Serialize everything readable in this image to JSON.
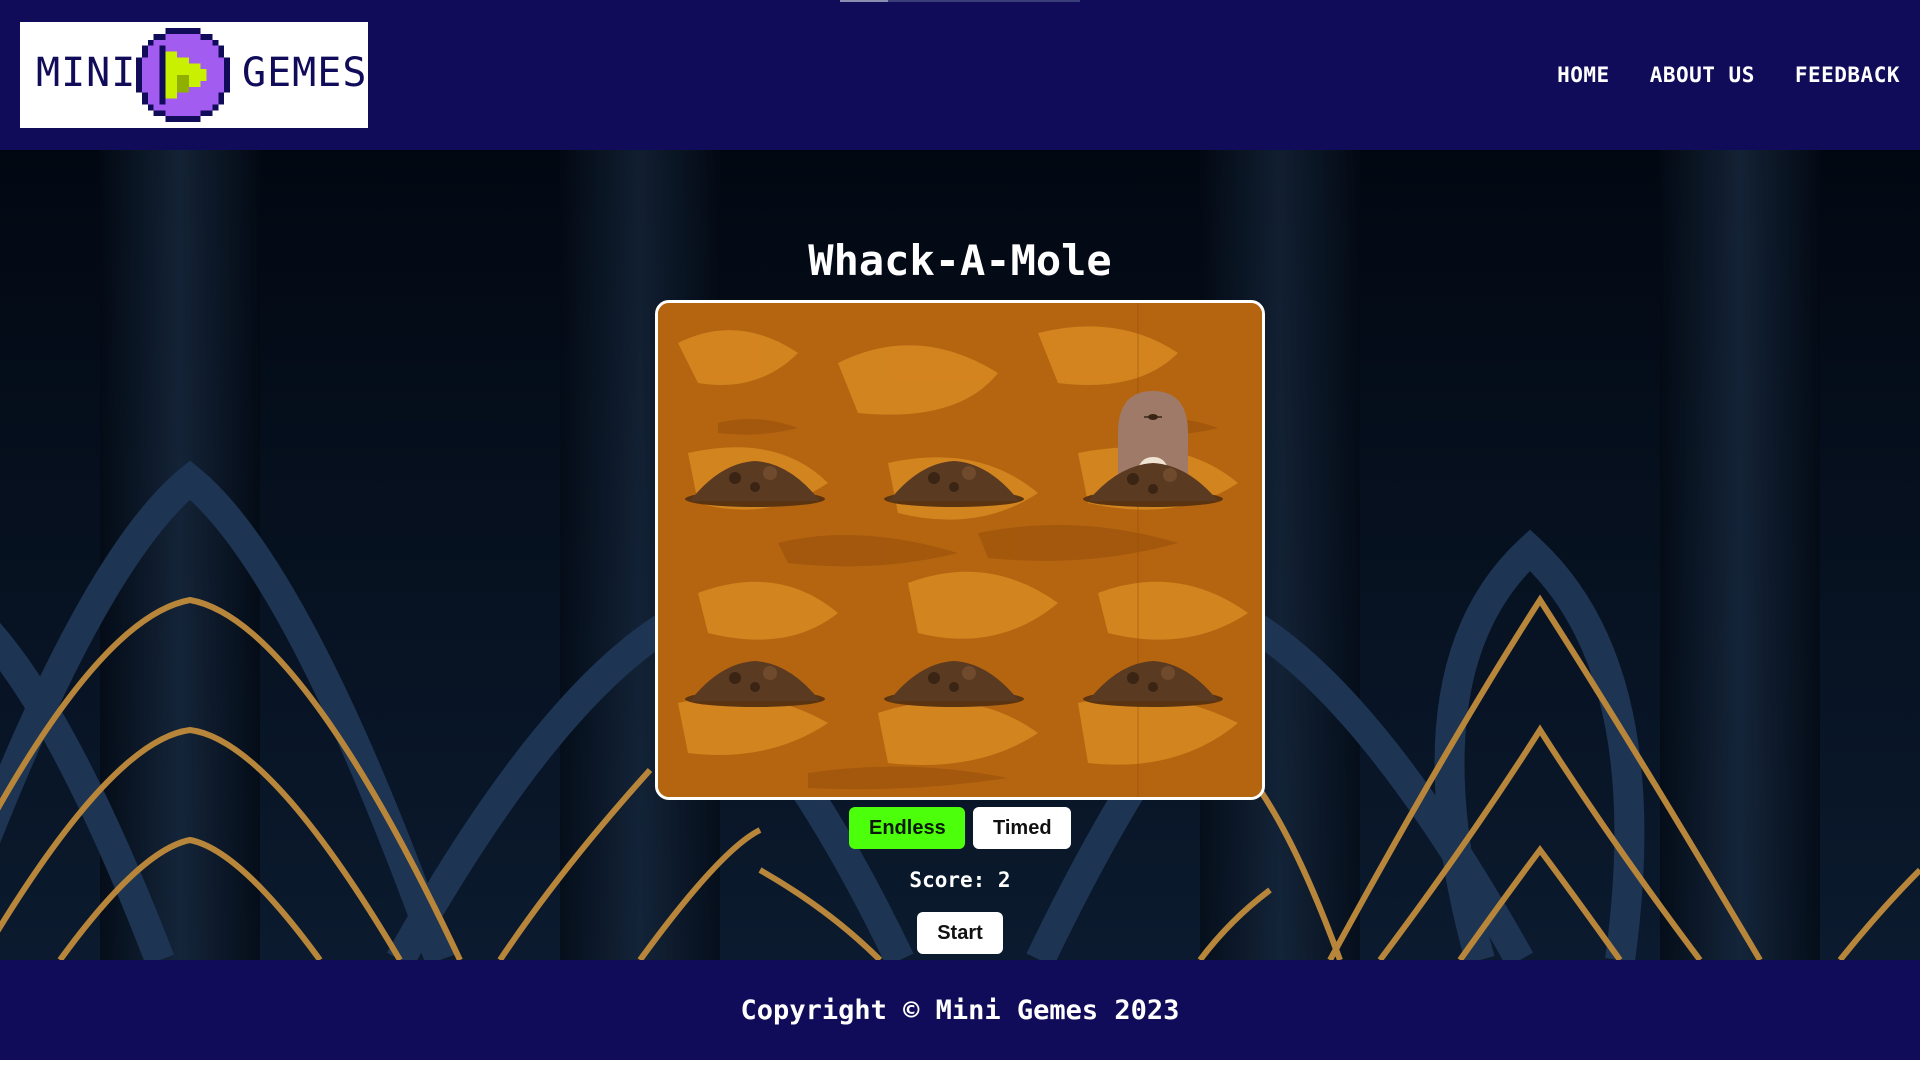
{
  "header": {
    "logo": {
      "word_left": "MINI",
      "word_right": "GEMES",
      "mark_icon": "pixel-play-coin-icon"
    },
    "nav": [
      {
        "label": "HOME"
      },
      {
        "label": "ABOUT US"
      },
      {
        "label": "FEEDBACK"
      }
    ]
  },
  "game": {
    "title": "Whack-A-Mole",
    "holes": 6,
    "mole_visible_in_hole": 3,
    "modes": [
      {
        "label": "Endless",
        "selected": true
      },
      {
        "label": "Timed",
        "selected": false
      }
    ],
    "score_label": "Score: 2",
    "start_label": "Start"
  },
  "footer": {
    "copyright": "Copyright © Mini Gemes 2023"
  },
  "colors": {
    "header_bg": "#110c59",
    "accent_green": "#4cff0a",
    "dirt": "#b0640f",
    "logo_purple": "#a25cf0",
    "logo_lime": "#c8f000"
  }
}
